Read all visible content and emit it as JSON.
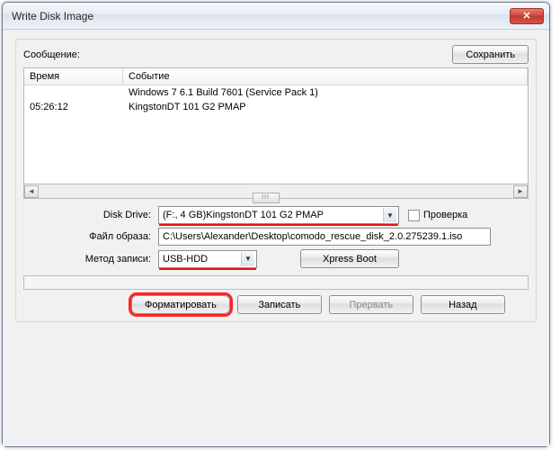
{
  "window": {
    "title": "Write Disk Image"
  },
  "topGroup": {
    "messageLabel": "Сообщение:",
    "saveButton": "Сохранить",
    "columns": {
      "time": "Время",
      "event": "Событие"
    },
    "rows": [
      {
        "time": "",
        "event": "Windows 7 6.1 Build 7601 (Service Pack 1)"
      },
      {
        "time": "05:26:12",
        "event": "KingstonDT 101 G2      PMAP"
      }
    ]
  },
  "form": {
    "diskDriveLabel": "Disk Drive:",
    "diskDriveValue": "(F:, 4 GB)KingstonDT 101 G2      PMAP",
    "verifyLabel": "Проверка",
    "imageFileLabel": "Файл образа:",
    "imageFileValue": "C:\\Users\\Alexander\\Desktop\\comodo_rescue_disk_2.0.275239.1.iso",
    "writeMethodLabel": "Метод записи:",
    "writeMethodValue": "USB-HDD",
    "xpressBootButton": "Xpress Boot"
  },
  "buttons": {
    "format": "Форматировать",
    "write": "Записать",
    "abort": "Прервать",
    "back": "Назад"
  },
  "icons": {
    "close": "✕",
    "chevron_down": "▼",
    "chevron_left": "◄",
    "chevron_right": "►"
  }
}
